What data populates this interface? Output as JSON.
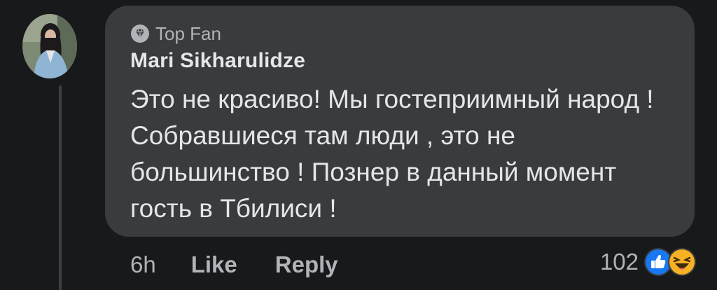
{
  "comment": {
    "badge_label": "Top Fan",
    "author": "Mari Sikharulidze",
    "text": "Это не красиво! Мы гостеприимный народ ! Собравшиеся там люди , это не большинство ! Познер в данный момент гость в Тбилиси !",
    "time": "6h",
    "like_label": "Like",
    "reply_label": "Reply",
    "reaction_count": "102",
    "reaction_icons": [
      "like-icon",
      "haha-icon"
    ]
  },
  "colors": {
    "background": "#18191a",
    "bubble": "#3a3b3c",
    "primary_text": "#e4e6eb",
    "secondary_text": "#b0b3b8",
    "like_blue": "#1877f2",
    "haha_yellow": "#f7b125"
  }
}
